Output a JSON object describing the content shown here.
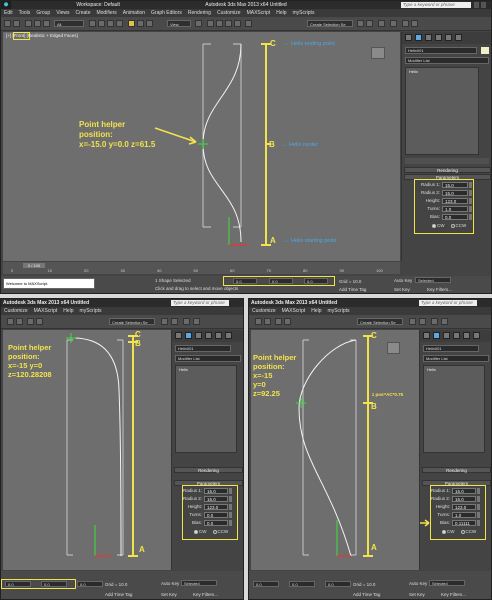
{
  "colors": {
    "accent_yellow": "#f2e34b",
    "annotation_blue": "#4aa8e8",
    "helix_white": "#f0f0f0",
    "point_green": "#3be03b"
  },
  "top": {
    "title_prefix": "Workspace: Default",
    "title": "Autodesk 3ds Max 2013 x64     Untitled",
    "search_placeholder": "Type a keyword or phrase",
    "menu": [
      "Edit",
      "Tools",
      "Group",
      "Views",
      "Create",
      "Modifiers",
      "Animation",
      "Graph Editors",
      "Rendering",
      "Customize",
      "MAXScript",
      "Help",
      "myScripts"
    ],
    "selection_filter": "All",
    "view_dropdown": "View",
    "named_selection": "Create Selection Se",
    "viewport_label": "[+] [Front] [Realistic + Edged Faces]",
    "object_name": "Helix001",
    "modifier_list": "Modifier List",
    "stack_item": "Helix",
    "rollouts": [
      "Rendering",
      "Parameters"
    ],
    "params": [
      {
        "label": "Radius 1:",
        "value": "15.0"
      },
      {
        "label": "Radius 2:",
        "value": "15.0"
      },
      {
        "label": "Height:",
        "value": "123.0"
      },
      {
        "label": "Turns:",
        "value": "1.0"
      },
      {
        "label": "Bias:",
        "value": "0.0"
      }
    ],
    "direction": {
      "cw": "CW",
      "ccw": "CCW",
      "selected": "CW"
    },
    "annotations": {
      "point_helper": [
        "Point helper",
        "position:",
        "x=-15.0 y=0.0 z=61.5"
      ],
      "letters": [
        "C",
        "B",
        "A"
      ],
      "helix_ending": "← Helix ending point",
      "helix_center": "← Helix center",
      "helix_starting": "← Helix starting point"
    },
    "timeline_label": "0 / 100",
    "ticks": [
      "0",
      "10",
      "20",
      "30",
      "40",
      "50",
      "60",
      "70",
      "80",
      "90",
      "100"
    ],
    "maxscript": "Welcome to MAXScript.",
    "status_line1": "1 Shape Selected",
    "status_line2": "Click and drag to select and move objects",
    "coords": {
      "x": "0.0",
      "y": "0.0",
      "z": "0.0"
    },
    "grid": "Grid = 10.0",
    "add_time_tag": "Add Time Tag",
    "auto_key": "Auto Key",
    "set_key": "Set Key",
    "key_mode": "Selected",
    "key_filters": "Key Filters..."
  },
  "bottom_left": {
    "title": "Autodesk 3ds Max 2013 x64     Untitled",
    "search_placeholder": "Type a keyword or phrase",
    "menu": [
      "Customize",
      "MAXScript",
      "Help",
      "myScripts"
    ],
    "named_selection": "Create Selection Se",
    "object_name": "Helix001",
    "modifier_list": "Modifier List",
    "stack_item": "Helix",
    "rollouts": [
      "Rendering",
      "Parameters"
    ],
    "params": [
      {
        "label": "Radius 1:",
        "value": "15.0"
      },
      {
        "label": "Radius 2:",
        "value": "15.0"
      },
      {
        "label": "Height:",
        "value": "123.0"
      },
      {
        "label": "Turns:",
        "value": "0.0"
      },
      {
        "label": "Bias:",
        "value": "0.0"
      }
    ],
    "direction": {
      "cw": "CW",
      "ccw": "CCW",
      "selected": "CW"
    },
    "annotations": {
      "point_helper": [
        "Point helper",
        "position:",
        "x=-15 y=0",
        "z=120.28208"
      ],
      "letters": [
        "C",
        "B",
        "A"
      ]
    },
    "coords": {
      "x": "0.0",
      "y": "0.0",
      "z": "0.0"
    },
    "grid": "Grid = 10.0",
    "add_time_tag": "Add Time Tag",
    "auto_key": "Auto Key",
    "set_key": "Set Key",
    "key_mode": "Selected",
    "key_filters": "Key Filters..."
  },
  "bottom_right": {
    "title": "Autodesk 3ds Max 2013 x64     Untitled",
    "search_placeholder": "Type a keyword or phrase",
    "menu": [
      "Customize",
      "MAXScript",
      "Help",
      "myScripts"
    ],
    "named_selection": "Create Selection Se",
    "object_name": "Helix001",
    "modifier_list": "Modifier List",
    "stack_item": "Helix",
    "rollouts": [
      "Rendering",
      "Parameters"
    ],
    "params": [
      {
        "label": "Radius 1:",
        "value": "15.0"
      },
      {
        "label": "Radius 2:",
        "value": "15.0"
      },
      {
        "label": "Height:",
        "value": "123.0"
      },
      {
        "label": "Turns:",
        "value": "1.0"
      },
      {
        "label": "Bias:",
        "value": "0.11111"
      }
    ],
    "direction": {
      "cw": "CW",
      "ccw": "CCW",
      "selected": "CW"
    },
    "annotations": {
      "point_helper": [
        "Point helper",
        "position:",
        "x=-15",
        "y=0",
        "z=92.25"
      ],
      "formula": "z pos=AC*0.75",
      "letters": [
        "C",
        "B",
        "A"
      ]
    },
    "coords": {
      "x": "0.0",
      "y": "0.0",
      "z": "0.0"
    },
    "grid": "Grid = 10.0",
    "add_time_tag": "Add Time Tag",
    "auto_key": "Auto Key",
    "set_key": "Set Key",
    "key_mode": "Selected",
    "key_filters": "Key Filters..."
  }
}
